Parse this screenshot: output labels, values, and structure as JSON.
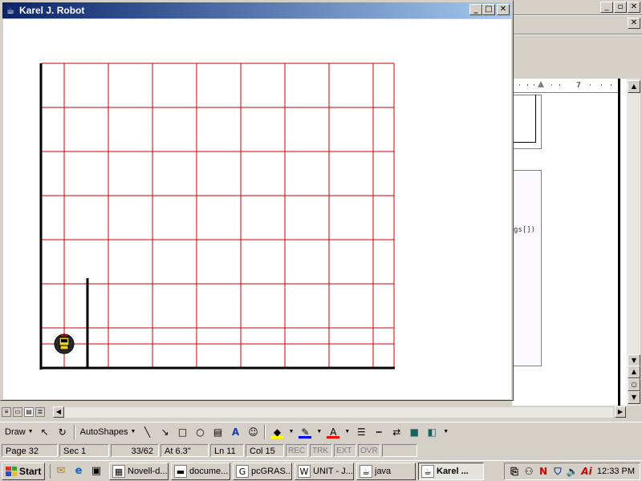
{
  "karel_window": {
    "title": "Karel J. Robot",
    "controls": {
      "minimize": "_",
      "maximize": "□",
      "close": "✕"
    },
    "world": {
      "streets": 7,
      "avenues": 8,
      "grid_color": "#cc0000",
      "wall_color": "#000000",
      "robot": {
        "street": 1,
        "avenue": 1,
        "icon": "robot-icon"
      },
      "wall_segments": [
        {
          "type": "vertical",
          "after_avenue": 1,
          "from_street": 1,
          "to_street": 2.5
        }
      ]
    }
  },
  "background_app": {
    "menu_controls": {
      "minimize": "_",
      "restore": "▫",
      "close": "✕"
    },
    "doc_close": "✕",
    "ruler_number": "7",
    "code_fragment": "gs[])"
  },
  "draw_toolbar": {
    "draw_label": "Draw",
    "autoshapes_label": "AutoShapes"
  },
  "status_bar": {
    "page": "Page 32",
    "section": "Sec 1",
    "page_of": "33/62",
    "at": "At 6.3\"",
    "line": "Ln 11",
    "col": "Col 15",
    "flags": [
      "REC",
      "TRK",
      "EXT",
      "OVR"
    ]
  },
  "taskbar": {
    "start_label": "Start",
    "tasks": [
      {
        "label": "Novell-d...",
        "icon": "novell-icon",
        "active": false
      },
      {
        "label": "docume...",
        "icon": "folder-icon",
        "active": false
      },
      {
        "label": "pcGRAS...",
        "icon": "pcgrasp-icon",
        "active": false
      },
      {
        "label": "UNIT - J...",
        "icon": "word-icon",
        "active": false
      },
      {
        "label": "java",
        "icon": "java-icon",
        "active": false
      },
      {
        "label": "Karel ...",
        "icon": "java-cup-icon",
        "active": true
      }
    ],
    "clock": "12:33 PM"
  }
}
